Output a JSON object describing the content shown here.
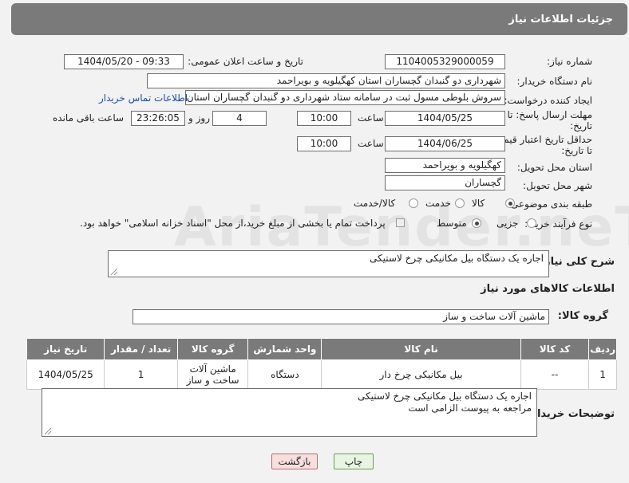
{
  "header": {
    "title": "جزئیات اطلاعات نیاز"
  },
  "fields": {
    "need_number_label": "شماره نیاز:",
    "need_number": "1104005329000059",
    "announce_label": "تاریخ و ساعت اعلان عمومی:",
    "announce_value": "1404/05/20 - 09:33",
    "buyer_org_label": "نام دستگاه خریدار:",
    "buyer_org": "شهرداری دو گنبدان گچساران استان کهگیلویه و بویراحمد",
    "creator_label": "ایجاد کننده درخواست:",
    "creator": "سروش بلوطی مسول ثبت در سامانه ستاد شهرداری دو گنبدان گچساران استان",
    "contact_link": "اطلاعات تماس خریدار",
    "deadline_label_1": "مهلت ارسال پاسخ: تا",
    "deadline_label_2": "تاریخ:",
    "deadline_date": "1404/05/25",
    "time_label": "ساعت",
    "deadline_time": "10:00",
    "days_value": "4",
    "days_label": "روز و",
    "remaining_time": "23:26:05",
    "remaining_label": "ساعت باقی مانده",
    "min_validity_label_1": "حداقل تاریخ اعتبار قیمت:",
    "min_validity_label_2": "تا تاریخ:",
    "validity_date": "1404/06/25",
    "validity_time": "10:00",
    "province_label": "استان محل تحویل:",
    "province": "کهگیلویه و بویراحمد",
    "city_label": "شهر محل تحویل:",
    "city": "گچساران",
    "category_label": "طبقه بندی موضوعی:",
    "category_options": [
      "کالا",
      "خدمت",
      "کالا/خدمت"
    ],
    "process_label": "نوع فرآیند خرید :",
    "process_options": [
      "جزیی",
      "متوسط"
    ],
    "payment_note": "پرداخت تمام یا بخشی از مبلغ خرید،از محل \"اسناد خزانه اسلامی\" خواهد بود."
  },
  "description": {
    "label": "شرح کلی نیاز:",
    "value": "اجاره یک دستگاه بیل مکانیکی چرخ لاستیکی"
  },
  "goods_info": {
    "title": "اطلاعات کالاهای مورد نیاز",
    "group_label": "گروه کالا:",
    "group_value": "ماشین آلات ساخت و ساز"
  },
  "table": {
    "headers": [
      "ردیف",
      "کد کالا",
      "نام کالا",
      "واحد شمارش",
      "گروه کالا",
      "تعداد / مقدار",
      "تاریخ نیاز"
    ],
    "rows": [
      {
        "row": "1",
        "code": "--",
        "name": "بیل مکانیکی چرخ دار",
        "unit": "دستگاه",
        "group": "ماشین آلات ساخت و ساز",
        "qty": "1",
        "date": "1404/05/25"
      }
    ]
  },
  "buyer_notes": {
    "label": "توضیحات خریدار:",
    "line1": "اجاره یک دستگاه بیل مکانیکی چرخ لاستیکی",
    "line2": "مراجعه به پیوست الزامی است"
  },
  "buttons": {
    "print": "چاپ",
    "back": "بازگشت"
  },
  "watermark": "AriaTender.neT"
}
